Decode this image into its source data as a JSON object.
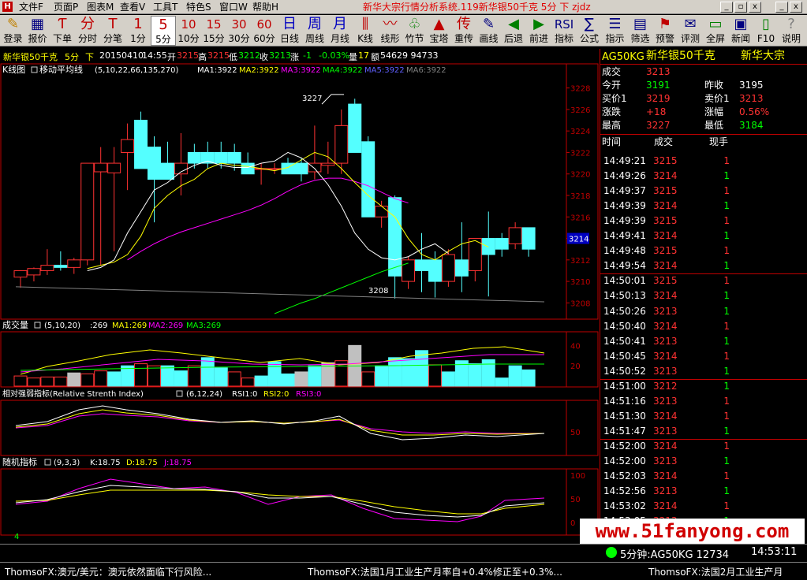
{
  "titlebar": {
    "menus": [
      "文件F",
      "页面P",
      "图表M",
      "查看V",
      "工具T",
      "特色S",
      "窗口W",
      "帮助H"
    ],
    "title": "新华大宗行情分析系统.119新华银50千克  5分  下  zjdz",
    "controls": [
      "_",
      "▫",
      "x"
    ]
  },
  "toolbar": {
    "items": [
      {
        "icon": "✎",
        "label": "登录",
        "color": "#c08000"
      },
      {
        "icon": "▦",
        "label": "报价",
        "color": "#000080"
      },
      {
        "icon": "Ƭ",
        "label": "下单",
        "color": "#c00000"
      },
      {
        "icon": "分",
        "label": "分时",
        "color": "#c00000"
      },
      {
        "icon": "T",
        "label": "分笔",
        "color": "#c00000"
      },
      {
        "icon": "1",
        "label": "1分",
        "color": "#c00000"
      },
      {
        "icon": "5",
        "label": "5分",
        "color": "#c00000"
      },
      {
        "icon": "10",
        "label": "10分",
        "color": "#c00000"
      },
      {
        "icon": "15",
        "label": "15分",
        "color": "#c00000"
      },
      {
        "icon": "30",
        "label": "30分",
        "color": "#c00000"
      },
      {
        "icon": "60",
        "label": "60分",
        "color": "#c00000"
      },
      {
        "icon": "日",
        "label": "日线",
        "color": "#0000c0"
      },
      {
        "icon": "周",
        "label": "周线",
        "color": "#0000c0"
      },
      {
        "icon": "月",
        "label": "月线",
        "color": "#0000c0"
      },
      {
        "icon": "⫼",
        "label": "K线",
        "color": "#c00000"
      },
      {
        "icon": "〰",
        "label": "线形",
        "color": "#c00000"
      },
      {
        "icon": "♧",
        "label": "竹节",
        "color": "#008000"
      },
      {
        "icon": "▲",
        "label": "宝塔",
        "color": "#c00000"
      },
      {
        "icon": "传",
        "label": "重传",
        "color": "#c00000"
      },
      {
        "icon": "✎",
        "label": "画线",
        "color": "#000080"
      },
      {
        "icon": "◀",
        "label": "后退",
        "color": "#008000"
      },
      {
        "icon": "▶",
        "label": "前进",
        "color": "#008000"
      },
      {
        "icon": "RSI",
        "label": "指标",
        "color": "#000080"
      },
      {
        "icon": "∑",
        "label": "公式",
        "color": "#000080"
      },
      {
        "icon": "☰",
        "label": "指示",
        "color": "#000080"
      },
      {
        "icon": "▤",
        "label": "筛选",
        "color": "#000080"
      },
      {
        "icon": "⚑",
        "label": "预警",
        "color": "#c00000"
      },
      {
        "icon": "✉",
        "label": "评测",
        "color": "#000080"
      },
      {
        "icon": "▭",
        "label": "全屏",
        "color": "#008000"
      },
      {
        "icon": "▣",
        "label": "新闻",
        "color": "#000080"
      },
      {
        "icon": "▯",
        "label": "F10",
        "color": "#008000"
      },
      {
        "icon": "?",
        "label": "说明",
        "color": "#808080"
      }
    ]
  },
  "info": {
    "name": "新华银50千克",
    "period": "5分",
    "dir": "下",
    "date": "20150410",
    "time": "14:55",
    "open_l": "开",
    "open": "3215",
    "high_l": "高",
    "high": "3215",
    "low_l": "低",
    "low": "3212",
    "close_l": "收",
    "close": "3213",
    "chg_l": "涨",
    "chg": "-1",
    "pct": "-0.03%",
    "vol_l": "量",
    "vol": "17",
    "amt_l": "额",
    "amt": "54629 94733"
  },
  "panels": {
    "k": {
      "title": "K线图",
      "sub": "移动平均线",
      "params": "(5,10,22,66,135,270)",
      "ma": [
        "MA1:3922",
        "MA2:3922",
        "MA3:3922",
        "MA4:3922",
        "MA5:3922",
        "MA6:3922"
      ]
    },
    "vol": {
      "title": "成交量",
      "params": "(5,10,20)",
      "val": ":269",
      "ma": [
        "MA1:269",
        "MA2:269",
        "MA3:269"
      ]
    },
    "rsi": {
      "title": "相对强弱指标(Relative Strenth Index)",
      "params": "(6,12,24)",
      "vals": [
        "RSI1:0",
        "RSI2:0",
        "RSI3:0"
      ]
    },
    "kdj": {
      "title": "随机指标",
      "params": "(9,3,3)",
      "vals": [
        "K:18.75",
        "D:18.75",
        "J:18.75"
      ]
    },
    "scrollnum": "4",
    "k_high_label": "3227",
    "k_low_label": "3208",
    "last_price_tag": "3214"
  },
  "axes": {
    "k_ticks": [
      "3228",
      "3226",
      "3224",
      "3222",
      "3220",
      "3218",
      "3216",
      "3214",
      "3212",
      "3210",
      "3208"
    ],
    "vol_ticks": [
      "40",
      "20"
    ],
    "rsi_ticks": [
      "50"
    ],
    "kdj_ticks": [
      "100",
      "50",
      "0"
    ]
  },
  "chart_data": [
    {
      "type": "candlestick",
      "title": "新华银50千克 5分",
      "ylim": [
        3207,
        3229
      ],
      "candles": [
        {
          "o": 3210.4,
          "h": 3210.8,
          "l": 3209.4,
          "c": 3211.0
        },
        {
          "o": 3210.6,
          "h": 3211.3,
          "l": 3210.0,
          "c": 3211.2
        },
        {
          "o": 3211.0,
          "h": 3213.0,
          "l": 3210.6,
          "c": 3211.5
        },
        {
          "o": 3211.5,
          "h": 3212.8,
          "l": 3211.0,
          "c": 3211.3
        },
        {
          "o": 3211.3,
          "h": 3212.2,
          "l": 3210.7,
          "c": 3212.0
        },
        {
          "o": 3212.0,
          "h": 3221.0,
          "l": 3211.5,
          "c": 3221.0
        },
        {
          "o": 3220.2,
          "h": 3222.5,
          "l": 3211.5,
          "c": 3221.0
        },
        {
          "o": 3220.1,
          "h": 3222.5,
          "l": 3212.8,
          "c": 3221.0
        },
        {
          "o": 3222.0,
          "h": 3224.7,
          "l": 3218.5,
          "c": 3223.2
        },
        {
          "o": 3225.0,
          "h": 3225.8,
          "l": 3220.5,
          "c": 3220.5
        },
        {
          "o": 3222.5,
          "h": 3223.5,
          "l": 3215.5,
          "c": 3219.5
        },
        {
          "o": 3221.0,
          "h": 3223.0,
          "l": 3219.5,
          "c": 3219.5
        },
        {
          "o": 3220.0,
          "h": 3223.8,
          "l": 3218.0,
          "c": 3221.0
        },
        {
          "o": 3222.0,
          "h": 3222.8,
          "l": 3220.5,
          "c": 3221.0
        },
        {
          "o": 3222.0,
          "h": 3223.0,
          "l": 3220.5,
          "c": 3221.0
        },
        {
          "o": 3222.0,
          "h": 3223.0,
          "l": 3220.5,
          "c": 3221.0
        },
        {
          "o": 3222.0,
          "h": 3222.8,
          "l": 3220.3,
          "c": 3221.0
        },
        {
          "o": 3221.0,
          "h": 3222.0,
          "l": 3220.5,
          "c": 3220.0
        },
        {
          "o": 3220.5,
          "h": 3221.0,
          "l": 3219.0,
          "c": 3220.5
        },
        {
          "o": 3220.5,
          "h": 3221.0,
          "l": 3220.0,
          "c": 3220.5
        },
        {
          "o": 3221.0,
          "h": 3221.5,
          "l": 3220.0,
          "c": 3220.0
        },
        {
          "o": 3221.0,
          "h": 3221.5,
          "l": 3219.3,
          "c": 3220.0
        },
        {
          "o": 3220.2,
          "h": 3224.5,
          "l": 3219.5,
          "c": 3221.0
        },
        {
          "o": 3220.8,
          "h": 3223.0,
          "l": 3220.0,
          "c": 3221.0
        },
        {
          "o": 3221.0,
          "h": 3226.0,
          "l": 3220.0,
          "c": 3224.5
        },
        {
          "o": 3226.5,
          "h": 3227.0,
          "l": 3222.0,
          "c": 3222.0
        },
        {
          "o": 3223.0,
          "h": 3223.5,
          "l": 3216.0,
          "c": 3216.0
        },
        {
          "o": 3216.0,
          "h": 3217.5,
          "l": 3215.0,
          "c": 3217.0
        },
        {
          "o": 3217.8,
          "h": 3218.0,
          "l": 3208.4,
          "c": 3210.5
        },
        {
          "o": 3210.0,
          "h": 3212.3,
          "l": 3209.3,
          "c": 3212.0
        },
        {
          "o": 3212.0,
          "h": 3214.5,
          "l": 3209.0,
          "c": 3211.0
        },
        {
          "o": 3212.0,
          "h": 3212.8,
          "l": 3208.5,
          "c": 3210.0
        },
        {
          "o": 3210.0,
          "h": 3213.0,
          "l": 3209.5,
          "c": 3212.5
        },
        {
          "o": 3212.0,
          "h": 3215.5,
          "l": 3209.0,
          "c": 3210.5
        },
        {
          "o": 3211.0,
          "h": 3214.0,
          "l": 3210.0,
          "c": 3214.0
        },
        {
          "o": 3214.0,
          "h": 3216.5,
          "l": 3208.6,
          "c": 3212.5
        },
        {
          "o": 3214.0,
          "h": 3214.5,
          "l": 3212.3,
          "c": 3213.0
        },
        {
          "o": 3213.5,
          "h": 3215.5,
          "l": 3213.0,
          "c": 3215.0
        },
        {
          "o": 3215.0,
          "h": 3215.0,
          "l": 3212.3,
          "c": 3213.0
        }
      ],
      "ma_yellow": [
        3211.2,
        3211.5,
        3211.8,
        3212.5,
        3214.2,
        3216.8,
        3218.0,
        3218.9,
        3219.5,
        3220.5,
        3221.0,
        3220.8,
        3220.7,
        3220.5,
        3220.3,
        3220.6,
        3221.3,
        3222.0,
        3221.6,
        3220.5,
        3219.2,
        3218.0,
        3217.0,
        3216.0,
        3214.0,
        3212.5,
        3212.0,
        3212.8,
        3213.5,
        3213.8,
        3213.2
      ],
      "ma_magenta": [
        3212.0,
        3212.8,
        3213.5,
        3214.1,
        3214.6,
        3215.0,
        3215.4,
        3215.8,
        3216.2,
        3216.6,
        3217.1,
        3217.7,
        3218.4,
        3219.0,
        3219.4,
        3219.6,
        3219.6,
        3219.3,
        3218.9,
        3218.3,
        3217.7,
        3217.3
      ],
      "ma_white": [
        3211.0,
        3211.3,
        3212.0,
        3214.5,
        3216.5,
        3218.5,
        3219.2,
        3220.2,
        3220.8,
        3221.2,
        3220.8,
        3220.6,
        3220.6,
        3221.0,
        3221.2,
        3222.0,
        3221.5,
        3220.5,
        3219.0,
        3217.0,
        3214.5,
        3213.0,
        3212.2,
        3212.0,
        3212.3,
        3213.0,
        3213.5,
        3212.6
      ],
      "ma_green": [
        3207.0,
        3207.5,
        3208.0,
        3208.4,
        3208.9,
        3209.4,
        3209.9,
        3210.4,
        3210.9,
        3211.3,
        3211.7
      ]
    },
    {
      "type": "bar",
      "title": "成交量",
      "ylim": [
        0,
        48
      ],
      "values": [
        [
          10,
          "u"
        ],
        [
          8,
          "u"
        ],
        [
          9,
          "u"
        ],
        [
          9,
          "u"
        ],
        [
          13,
          "g"
        ],
        [
          12,
          "u"
        ],
        [
          15,
          "u"
        ],
        [
          14,
          "d"
        ],
        [
          20,
          "d"
        ],
        [
          22,
          "u"
        ],
        [
          20,
          "u"
        ],
        [
          20,
          "d"
        ],
        [
          15,
          "d"
        ],
        [
          20,
          "u"
        ],
        [
          28,
          "d"
        ],
        [
          18,
          "d"
        ],
        [
          14,
          "u"
        ],
        [
          8,
          "u"
        ],
        [
          10,
          "d"
        ],
        [
          24,
          "d"
        ],
        [
          12,
          "d"
        ],
        [
          14,
          "g"
        ],
        [
          20,
          "d"
        ],
        [
          23,
          "g"
        ],
        [
          25,
          "u"
        ],
        [
          40,
          "g"
        ],
        [
          14,
          "u"
        ],
        [
          20,
          "d"
        ],
        [
          28,
          "d"
        ],
        [
          27,
          "d"
        ],
        [
          35,
          "d"
        ],
        [
          21,
          "u"
        ],
        [
          14,
          "d"
        ],
        [
          25,
          "d"
        ],
        [
          22,
          "d"
        ],
        [
          26,
          "d"
        ],
        [
          8,
          "d"
        ],
        [
          20,
          "d"
        ],
        [
          16,
          "d"
        ]
      ]
    }
  ],
  "rightpanel": {
    "code": "AG50KG",
    "name": "新华银50千克",
    "exch": "新华大宗",
    "deal_l": "成交",
    "deal": "3213",
    "open_l": "今开",
    "open": "3191",
    "prev_l": "昨收",
    "prev": "3195",
    "bid_l": "买价1",
    "bid": "3219",
    "ask_l": "卖价1",
    "ask": "3213",
    "chg_l": "涨跌",
    "chg": "+18",
    "pct_l": "涨幅",
    "pct": "0.56%",
    "high_l": "最高",
    "high": "3227",
    "low_l": "最低",
    "low": "3184",
    "tick_headers": [
      "时间",
      "成交",
      "现手"
    ],
    "ticks": [
      [
        "14:49:21",
        "3215",
        "1",
        "r"
      ],
      [
        "14:49:26",
        "3214",
        "1",
        "g"
      ],
      [
        "14:49:37",
        "3215",
        "1",
        "r"
      ],
      [
        "14:49:39",
        "3214",
        "1",
        "g"
      ],
      [
        "14:49:39",
        "3215",
        "1",
        "r"
      ],
      [
        "14:49:41",
        "3214",
        "1",
        "g"
      ],
      [
        "14:49:48",
        "3215",
        "1",
        "r"
      ],
      [
        "14:49:54",
        "3214",
        "1",
        "g"
      ],
      [
        "14:50:01",
        "3215",
        "1",
        "r"
      ],
      [
        "14:50:13",
        "3214",
        "1",
        "g"
      ],
      [
        "14:50:26",
        "3213",
        "1",
        "g"
      ],
      [
        "14:50:40",
        "3214",
        "1",
        "r"
      ],
      [
        "14:50:41",
        "3213",
        "1",
        "g"
      ],
      [
        "14:50:45",
        "3214",
        "1",
        "r"
      ],
      [
        "14:50:52",
        "3213",
        "1",
        "g"
      ],
      [
        "14:51:00",
        "3212",
        "1",
        "g"
      ],
      [
        "14:51:16",
        "3213",
        "1",
        "r"
      ],
      [
        "14:51:30",
        "3214",
        "1",
        "r"
      ],
      [
        "14:51:47",
        "3213",
        "1",
        "g"
      ],
      [
        "14:52:00",
        "3214",
        "1",
        "r"
      ],
      [
        "14:52:00",
        "3213",
        "1",
        "g"
      ],
      [
        "14:52:03",
        "3214",
        "1",
        "r"
      ],
      [
        "14:52:56",
        "3213",
        "1",
        "g"
      ],
      [
        "14:53:02",
        "3214",
        "1",
        "r"
      ],
      [
        "14:53:05",
        "3213",
        "1",
        "g"
      ]
    ]
  },
  "statusbar": {
    "quote": "5分钟:AG50KG 12734",
    "clock": "14:53:11"
  },
  "ticker": [
    "ThomsoFX:澳元/美元：澳元依然面临下行风险...",
    "ThomsoFX:法国1月工业生产月率自+0.4%修正至+0.3%...",
    "ThomsoFX:法国2月工业生产月"
  ],
  "watermark": "www.51fanyong.com",
  "colors": {
    "up": "#ff3232",
    "down": "#54ffff",
    "grid": "#c00000",
    "ma_white": "#ffffff",
    "ma_yellow": "#ffff00",
    "ma_magenta": "#ff00ff",
    "ma_green": "#00ff00"
  }
}
